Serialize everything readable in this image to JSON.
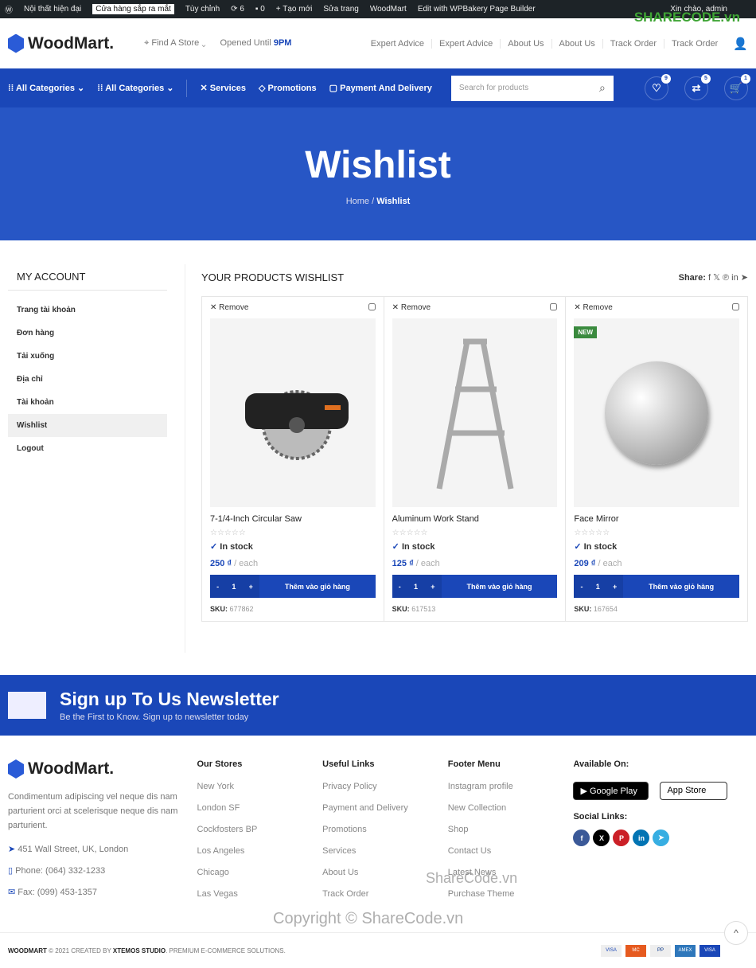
{
  "adminbar": {
    "site": "Nội thất hiện đại",
    "status": "Cửa hàng sắp ra mắt",
    "customize": "Tùy chỉnh",
    "updates": "6",
    "comments": "0",
    "new": "Tạo mới",
    "edit": "Sửa trang",
    "theme": "WoodMart",
    "builder": "Edit with WPBakery Page Builder",
    "greeting": "Xin chào, admin"
  },
  "header": {
    "logo": "WoodMart.",
    "find_store": "Find A Store",
    "opened": "Opened Until",
    "hours": "9PM",
    "links": [
      "Expert Advice",
      "Expert Advice",
      "About Us",
      "About Us",
      "Track Order",
      "Track Order"
    ]
  },
  "nav": {
    "items": [
      "All Categories",
      "All Categories",
      "Services",
      "Promotions",
      "Payment And Delivery"
    ],
    "search_placeholder": "Search for products",
    "wishlist_count": "9",
    "compare_count": "5",
    "cart_count": "1"
  },
  "hero": {
    "title": "Wishlist",
    "breadcrumb_home": "Home",
    "breadcrumb_current": "Wishlist"
  },
  "sidebar": {
    "title": "MY ACCOUNT",
    "items": [
      "Trang tài khoản",
      "Đơn hàng",
      "Tải xuống",
      "Địa chỉ",
      "Tài khoản",
      "Wishlist",
      "Logout"
    ]
  },
  "wishlist": {
    "title": "YOUR PRODUCTS WISHLIST",
    "share": "Share:",
    "remove": "Remove",
    "stock": "In stock",
    "each": "/ each",
    "add": "Thêm vào giỏ hàng",
    "sku_label": "SKU:",
    "new_badge": "NEW",
    "products": [
      {
        "name": "7-1/4-Inch Circular Saw",
        "price": "250 ₫",
        "sku": "677862",
        "qty": "1"
      },
      {
        "name": "Aluminum Work Stand",
        "price": "125 ₫",
        "sku": "617513",
        "qty": "1"
      },
      {
        "name": "Face Mirror",
        "price": "209 ₫",
        "sku": "167654",
        "qty": "1"
      }
    ]
  },
  "newsletter": {
    "title": "Sign up To Us Newsletter",
    "subtitle": "Be the First to Know. Sign up to newsletter today"
  },
  "footer": {
    "about": "Condimentum adipiscing vel neque dis nam parturient orci at scelerisque neque dis nam parturient.",
    "address": "451 Wall Street, UK, London",
    "phone": "Phone: (064) 332-1233",
    "fax": "Fax: (099) 453-1357",
    "cols": [
      {
        "title": "Our Stores",
        "items": [
          "New York",
          "London SF",
          "Cockfosters BP",
          "Los Angeles",
          "Chicago",
          "Las Vegas"
        ]
      },
      {
        "title": "Useful Links",
        "items": [
          "Privacy Policy",
          "Payment and Delivery",
          "Promotions",
          "Services",
          "About Us",
          "Track Order"
        ]
      },
      {
        "title": "Footer Menu",
        "items": [
          "Instagram profile",
          "New Collection",
          "Shop",
          "Contact Us",
          "Latest News",
          "Purchase Theme"
        ]
      }
    ],
    "available": "Available On:",
    "google": "Google Play",
    "apple": "App Store",
    "social": "Social Links:"
  },
  "bottom": {
    "brand": "WOODMART",
    "text1": "2021 CREATED BY",
    "studio": "XTEMOS STUDIO",
    "text2": ". PREMIUM E-COMMERCE SOLUTIONS."
  },
  "watermark": {
    "a": "ShareCode.vn",
    "b": "Copyright © ShareCode.vn",
    "logo": "SHARECODE.vn"
  },
  "colors": {
    "primary": "#1a47b8",
    "hero": "#2756c5"
  }
}
